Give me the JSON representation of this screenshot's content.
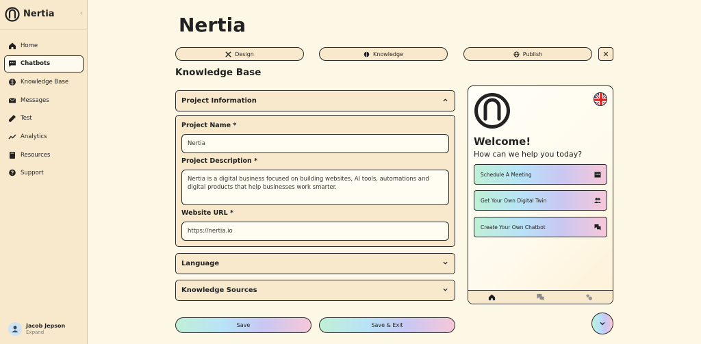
{
  "app": {
    "name": "Nertia",
    "collapse_glyph": "‹"
  },
  "sidebar": {
    "items": [
      {
        "label": "Home",
        "icon": "home-icon"
      },
      {
        "label": "Chatbots",
        "icon": "chat-icon",
        "active": true
      },
      {
        "label": "Knowledge Base",
        "icon": "brain-icon"
      },
      {
        "label": "Messages",
        "icon": "envelope-icon"
      },
      {
        "label": "Test",
        "icon": "flask-icon"
      },
      {
        "label": "Analytics",
        "icon": "trend-icon"
      },
      {
        "label": "Resources",
        "icon": "book-icon"
      },
      {
        "label": "Support",
        "icon": "support-icon"
      }
    ],
    "user": {
      "name": "Jacob Jepson",
      "sub": "Expand"
    }
  },
  "header": {
    "title": "Nertia",
    "tabs": [
      {
        "label": "Design",
        "icon": "tools-icon"
      },
      {
        "label": "Knowledge",
        "icon": "brain-icon",
        "active": true
      },
      {
        "label": "Publish",
        "icon": "globe-icon"
      }
    ],
    "close_glyph": "✕"
  },
  "section": {
    "title": "Knowledge Base"
  },
  "accordions": {
    "project_info": {
      "title": "Project Information",
      "name_label": "Project Name *",
      "name_value": "Nertia",
      "desc_label": "Project Description *",
      "desc_value": "Nertia is a digital business focused on building websites, AI tools, automations and digital products that help businesses work smarter.",
      "url_label": "Website URL *",
      "url_value": "https://nertia.io"
    },
    "language": {
      "title": "Language"
    },
    "sources": {
      "title": "Knowledge Sources"
    }
  },
  "actions": {
    "save": "Save",
    "save_exit": "Save & Exit"
  },
  "preview": {
    "welcome": "Welcome!",
    "subtitle": "How can we help you today?",
    "buttons": [
      {
        "label": "Schedule A Meeting",
        "icon": "calendar-icon"
      },
      {
        "label": "Get Your Own Digital Twin",
        "icon": "users-icon"
      },
      {
        "label": "Create Your Own Chatbot",
        "icon": "chat-bubbles-icon"
      }
    ]
  },
  "colors": {
    "background": "#fdf8e6",
    "sidebar": "#f8e9cc",
    "border": "#2a2a2a"
  }
}
